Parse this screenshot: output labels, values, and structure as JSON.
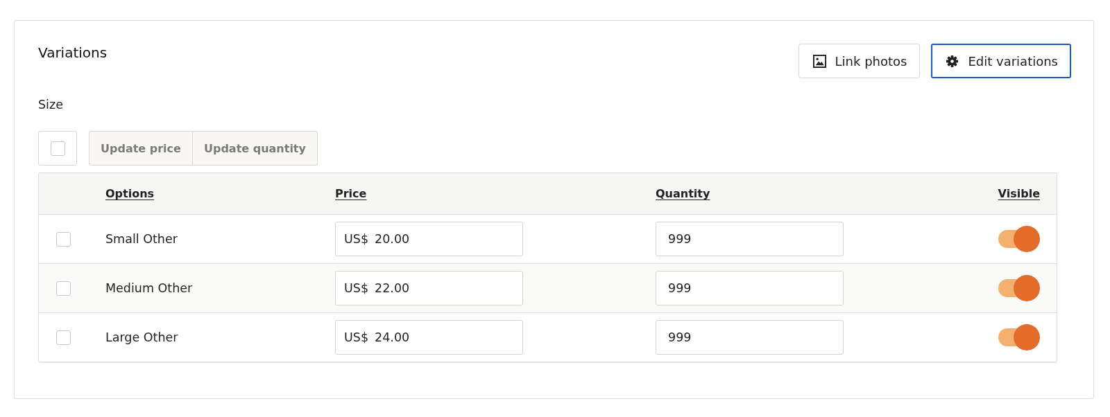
{
  "section": {
    "title": "Variations"
  },
  "toolbar_buttons": [
    {
      "kind": "photos",
      "label": "Link photos",
      "focused": false
    },
    {
      "kind": "settings",
      "label": "Edit variations",
      "focused": true
    }
  ],
  "property": {
    "label": "Size"
  },
  "bulk": {
    "checked": false,
    "actions": [
      {
        "label": "Update price",
        "disabled": true
      },
      {
        "label": "Update quantity",
        "disabled": true
      }
    ]
  },
  "table": {
    "columns": [
      "Options",
      "Price",
      "Quantity",
      "Visible"
    ],
    "rows": [
      {
        "checked": false,
        "option": "Small Other",
        "currency": "US$",
        "price": "20.00",
        "quantity": "999",
        "visible": true
      },
      {
        "checked": false,
        "option": "Medium Other",
        "currency": "US$",
        "price": "22.00",
        "quantity": "999",
        "visible": true
      },
      {
        "checked": false,
        "option": "Large Other",
        "currency": "US$",
        "price": "24.00",
        "quantity": "999",
        "visible": true
      }
    ]
  }
}
